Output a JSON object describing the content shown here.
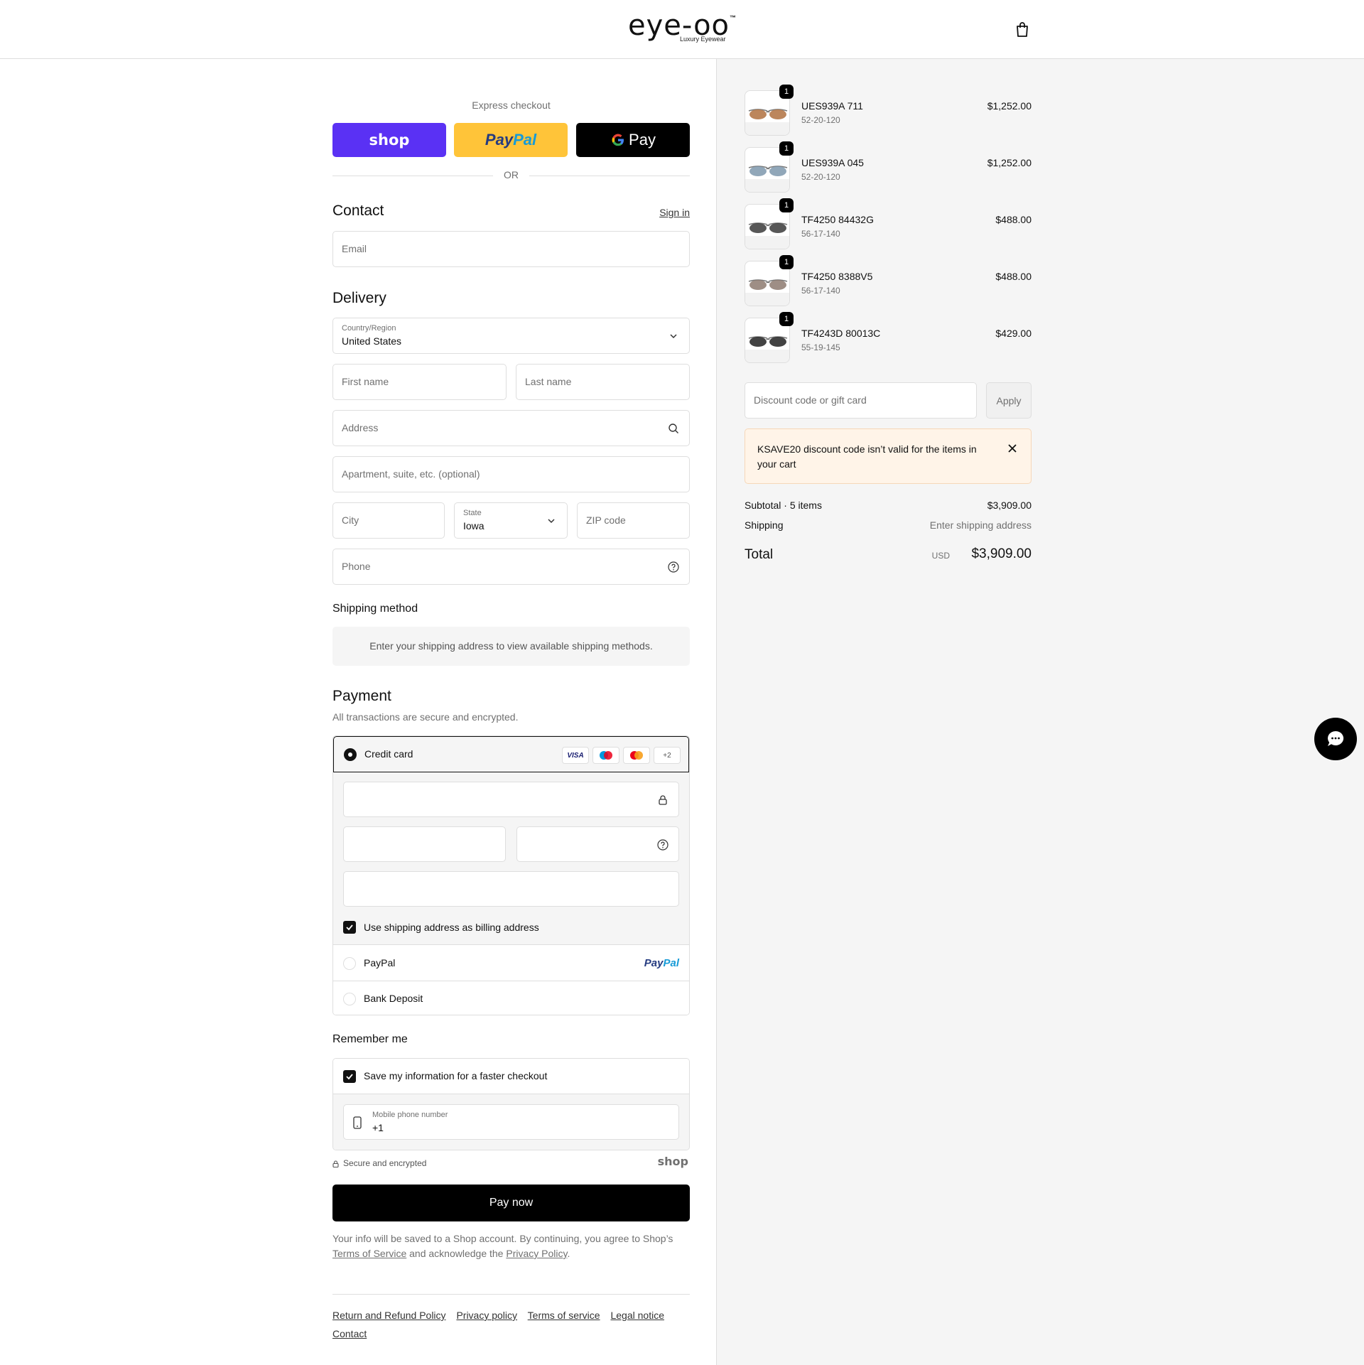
{
  "header": {
    "logo_text": "eye-oo",
    "logo_tm": "™",
    "logo_sub": "Luxury Eyewear"
  },
  "express": {
    "label": "Express checkout",
    "shop_label": "shop",
    "paypal_label_1": "Pay",
    "paypal_label_2": "Pal",
    "gpay_label": "Pay",
    "or_label": "OR"
  },
  "contact": {
    "heading": "Contact",
    "sign_in": "Sign in",
    "email_placeholder": "Email"
  },
  "delivery": {
    "heading": "Delivery",
    "country_label": "Country/Region",
    "country_value": "United States",
    "first_name": "First name",
    "last_name": "Last name",
    "address": "Address",
    "apartment": "Apartment, suite, etc. (optional)",
    "city": "City",
    "state_label": "State",
    "state_value": "Iowa",
    "zip": "ZIP code",
    "phone": "Phone"
  },
  "shipping_method": {
    "heading": "Shipping method",
    "message": "Enter your shipping address to view available shipping methods."
  },
  "payment": {
    "heading": "Payment",
    "subtitle": "All transactions are secure and encrypted.",
    "credit_card_label": "Credit card",
    "card_badges": [
      "VISA",
      "maestro",
      "mastercard",
      "+2"
    ],
    "billing_checkbox_label": "Use shipping address as billing address",
    "billing_checked": true,
    "paypal_label": "PayPal",
    "paypal_logo_1": "Pay",
    "paypal_logo_2": "Pal",
    "bank_label": "Bank Deposit"
  },
  "remember": {
    "heading": "Remember me",
    "save_label": "Save my information for a faster checkout",
    "save_checked": true,
    "mobile_label": "Mobile phone number",
    "mobile_value": "+1"
  },
  "secure": {
    "label": "Secure and encrypted",
    "shop_logo": "shop"
  },
  "pay_now_label": "Pay now",
  "legal": {
    "text_1": "Your info will be saved to a Shop account. By continuing, you agree to Shop’s",
    "terms": "Terms of Service",
    "text_2": "and acknowledge the",
    "privacy": "Privacy Policy",
    "text_3": "."
  },
  "footer_links": [
    "Return and Refund Policy",
    "Privacy policy",
    "Terms of service",
    "Legal notice",
    "Contact"
  ],
  "cart": {
    "items": [
      {
        "name": "UES939A 711",
        "variant": "52-20-120",
        "price": "$1,252.00",
        "qty": "1",
        "lens_color": "#b0713f"
      },
      {
        "name": "UES939A 045",
        "variant": "52-20-120",
        "price": "$1,252.00",
        "qty": "1",
        "lens_color": "#7e98ad"
      },
      {
        "name": "TF4250 84432G",
        "variant": "56-17-140",
        "price": "$488.00",
        "qty": "1",
        "lens_color": "#3a3a3a"
      },
      {
        "name": "TF4250 8388V5",
        "variant": "56-17-140",
        "price": "$488.00",
        "qty": "1",
        "lens_color": "#8d7a70"
      },
      {
        "name": "TF4243D 80013C",
        "variant": "55-19-145",
        "price": "$429.00",
        "qty": "1",
        "lens_color": "#222222"
      }
    ],
    "discount_placeholder": "Discount code or gift card",
    "apply_label": "Apply",
    "notice": "KSAVE20 discount code isn’t valid for the items in your cart",
    "subtotal_label": "Subtotal · 5 items",
    "subtotal_value": "$3,909.00",
    "shipping_label": "Shipping",
    "shipping_value": "Enter shipping address",
    "total_label": "Total",
    "currency": "USD",
    "total_value": "$3,909.00"
  },
  "colors": {
    "shop_purple": "#5a31f4",
    "paypal_yellow": "#ffc439",
    "notice_bg": "#fff4e8"
  }
}
